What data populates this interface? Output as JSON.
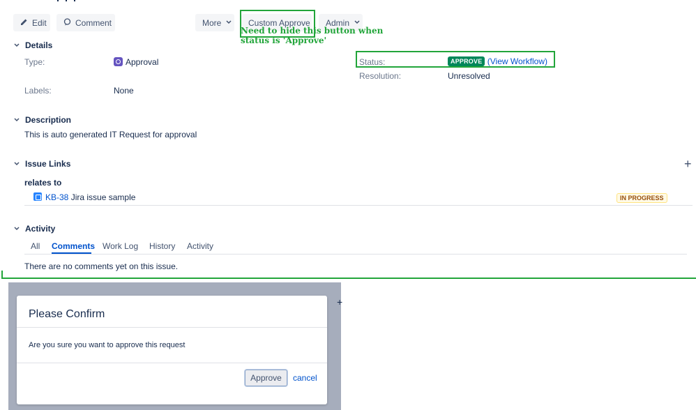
{
  "toolbar": {
    "edit_label": "Edit",
    "comment_label": "Comment",
    "more_label": "More",
    "custom_approve_label": "Custom Approve",
    "admin_label": "Admin"
  },
  "annotations": {
    "note_line1": "Need to hide this button when",
    "note_line2": "status is 'Approve'",
    "color": "#22a53a"
  },
  "details": {
    "heading": "Details",
    "type_label": "Type:",
    "type_value": "Approval",
    "labels_label": "Labels:",
    "labels_value": "None",
    "status_label": "Status:",
    "status_value": "APPROVE",
    "view_workflow": "(View Workflow)",
    "resolution_label": "Resolution:",
    "resolution_value": "Unresolved"
  },
  "description": {
    "heading": "Description",
    "text": "This is auto generated IT Request for approval"
  },
  "issue_links": {
    "heading": "Issue Links",
    "add_symbol": "+",
    "relation": "relates to",
    "issue_key": "KB-38",
    "issue_summary": "Jira issue sample",
    "issue_status": "IN PROGRESS"
  },
  "activity": {
    "heading": "Activity",
    "tabs": [
      "All",
      "Comments",
      "Work Log",
      "History",
      "Activity"
    ],
    "active_tab": "Comments",
    "empty_text": "There are no comments yet on this issue."
  },
  "modal": {
    "title": "Please Confirm",
    "body": "Are you sure you want to approve this request",
    "approve_label": "Approve",
    "cancel_label": "cancel",
    "background_plus": "+"
  },
  "colors": {
    "accent": "#0052cc",
    "approve_lozenge": "#00875a",
    "approval_icon": "#6554c0",
    "overlay": "#a6adbc"
  }
}
